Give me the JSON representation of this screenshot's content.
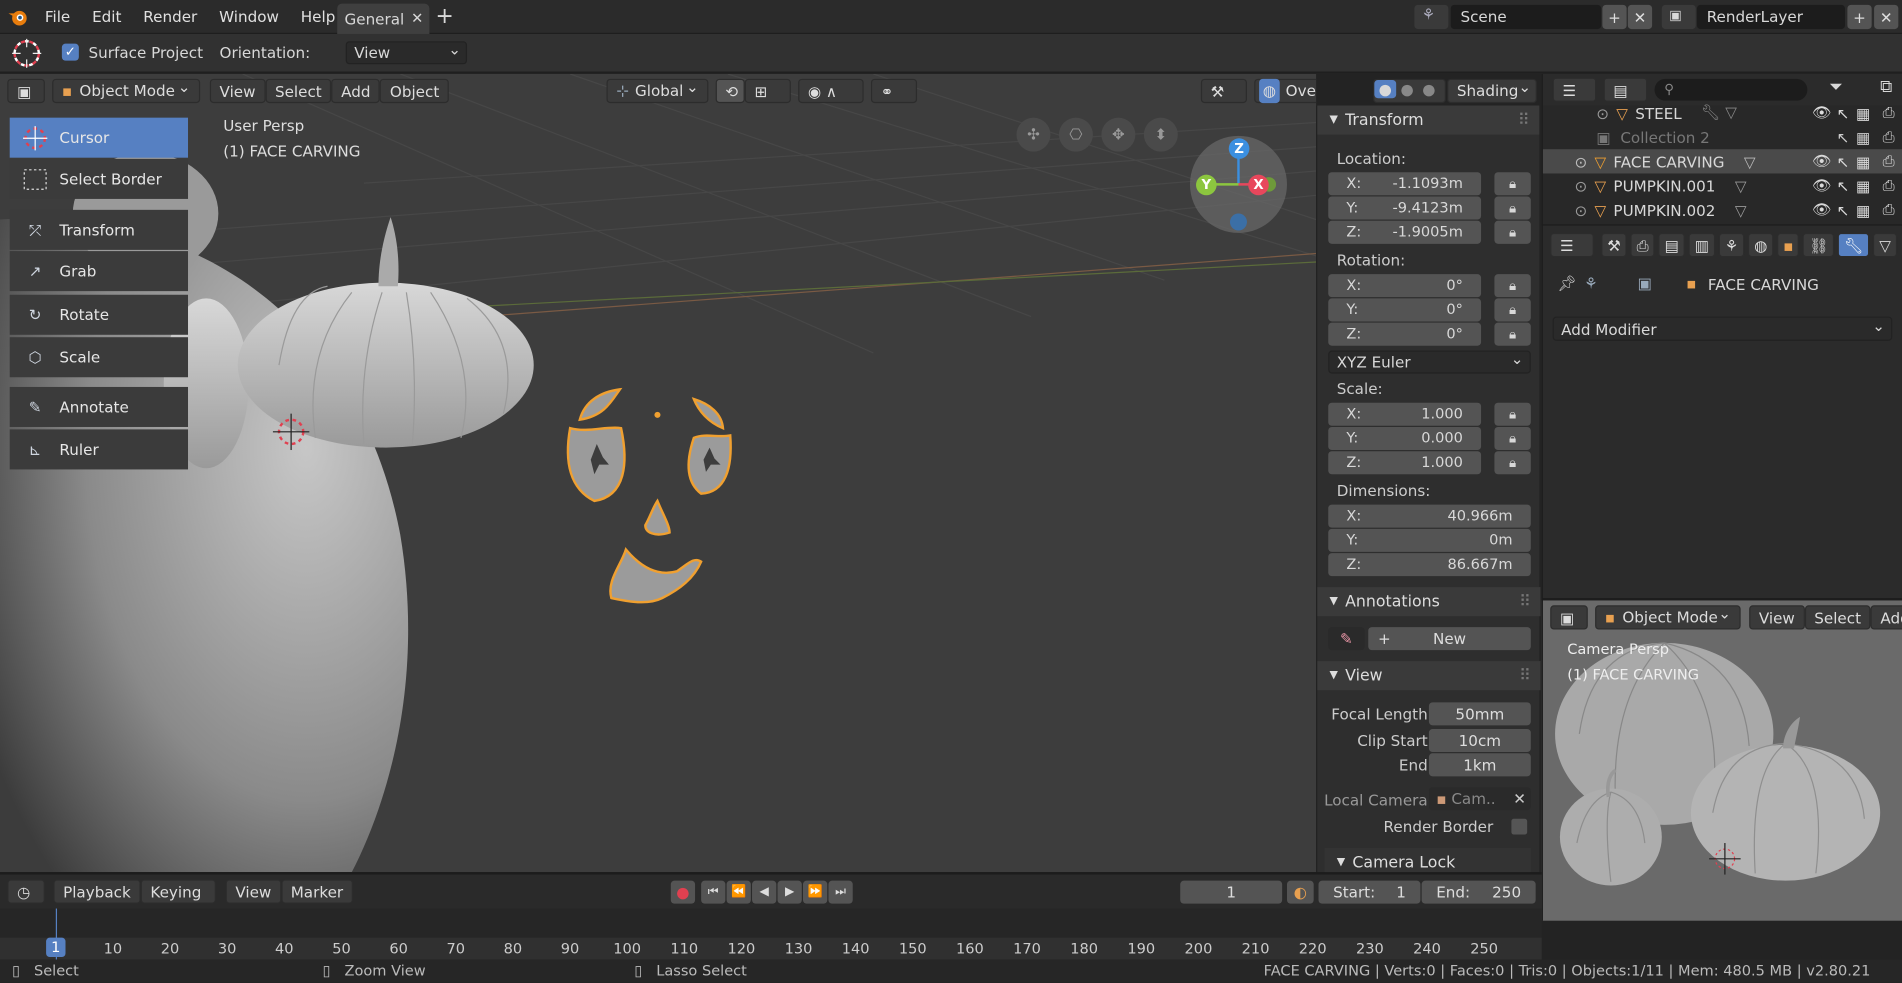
{
  "topbar": {
    "menus": [
      "File",
      "Edit",
      "Render",
      "Window",
      "Help"
    ],
    "workspace_tab": "General",
    "add_tab": "+",
    "scene_label": "Scene",
    "renderlayer_label": "RenderLayer"
  },
  "tool_settings": {
    "surface_project_label": "Surface Project",
    "surface_project_checked": true,
    "orientation_label": "Orientation:",
    "orientation_value": "View"
  },
  "viewport": {
    "mode": "Object Mode",
    "menus": [
      "View",
      "Select",
      "Add",
      "Object"
    ],
    "transform_orientation": "Global",
    "overlays_label": "Overlays",
    "shading_label": "Shading",
    "view_name": "User Persp",
    "object_info": "(1) FACE CARVING",
    "gizmo_axes": {
      "z": "Z",
      "y": "Y",
      "x": "X"
    }
  },
  "toolbar": {
    "tools": [
      {
        "label": "Cursor",
        "active": true
      },
      {
        "label": "Select Border",
        "active": false
      },
      {
        "label": "Transform",
        "active": false
      },
      {
        "label": "Grab",
        "active": false
      },
      {
        "label": "Rotate",
        "active": false
      },
      {
        "label": "Scale",
        "active": false
      },
      {
        "label": "Annotate",
        "active": false
      },
      {
        "label": "Ruler",
        "active": false
      }
    ]
  },
  "npanel": {
    "transform_title": "Transform",
    "location_label": "Location:",
    "location": [
      {
        "axis": "X:",
        "value": "-1.1093m"
      },
      {
        "axis": "Y:",
        "value": "-9.4123m"
      },
      {
        "axis": "Z:",
        "value": "-1.9005m"
      }
    ],
    "rotation_label": "Rotation:",
    "rotation": [
      {
        "axis": "X:",
        "value": "0°"
      },
      {
        "axis": "Y:",
        "value": "0°"
      },
      {
        "axis": "Z:",
        "value": "0°"
      }
    ],
    "rotation_mode": "XYZ Euler",
    "scale_label": "Scale:",
    "scale": [
      {
        "axis": "X:",
        "value": "1.000"
      },
      {
        "axis": "Y:",
        "value": "0.000"
      },
      {
        "axis": "Z:",
        "value": "1.000"
      }
    ],
    "dimensions_label": "Dimensions:",
    "dimensions": [
      {
        "axis": "X:",
        "value": "40.966m"
      },
      {
        "axis": "Y:",
        "value": "0m"
      },
      {
        "axis": "Z:",
        "value": "86.667m"
      }
    ],
    "annotations_title": "Annotations",
    "new_label": "New",
    "view_title": "View",
    "focal_length_label": "Focal Length",
    "focal_length_value": "50mm",
    "clip_start_label": "Clip Start",
    "clip_start_value": "10cm",
    "end_label": "End",
    "end_value": "1km",
    "local_camera_label": "Local Camera",
    "local_camera_value": "Cam..",
    "render_border_label": "Render Border",
    "camera_lock_title": "Camera Lock"
  },
  "outliner": {
    "rows": [
      {
        "name": "STEEL",
        "dim": false,
        "selected": false
      },
      {
        "name": "Collection 2",
        "dim": true,
        "selected": false
      },
      {
        "name": "FACE CARVING",
        "dim": false,
        "selected": true
      },
      {
        "name": "PUMPKIN.001",
        "dim": false,
        "selected": false
      },
      {
        "name": "PUMPKIN.002",
        "dim": false,
        "selected": false
      }
    ]
  },
  "properties": {
    "object_name": "FACE CARVING",
    "add_modifier": "Add Modifier"
  },
  "camera_view": {
    "mode": "Object Mode",
    "menus": [
      "View",
      "Select",
      "Add"
    ],
    "view_name": "Camera Persp",
    "object_info": "(1) FACE CARVING"
  },
  "timeline": {
    "menus": [
      "Playback",
      "Keying",
      "View",
      "Marker"
    ],
    "current_frame": "1",
    "start_label": "Start:",
    "start_value": "1",
    "end_label": "End:",
    "end_value": "250",
    "ticks": [
      "10",
      "20",
      "30",
      "40",
      "50",
      "60",
      "70",
      "80",
      "90",
      "100",
      "110",
      "120",
      "130",
      "140",
      "150",
      "160",
      "170",
      "180",
      "190",
      "200",
      "210",
      "220",
      "230",
      "240",
      "250"
    ],
    "playhead_label": "1"
  },
  "statusbar": {
    "select": "Select",
    "zoom_view": "Zoom View",
    "lasso_select": "Lasso Select",
    "stats": "FACE CARVING | Verts:0 | Faces:0 | Tris:0 | Objects:1/11 | Mem: 480.5 MB | v2.80.21"
  },
  "colors": {
    "accent": "#5680c2",
    "selection_orange": "#f0a030",
    "axis_x": "#e8475c",
    "axis_y": "#8cc63f",
    "axis_z": "#3b8fe0"
  }
}
